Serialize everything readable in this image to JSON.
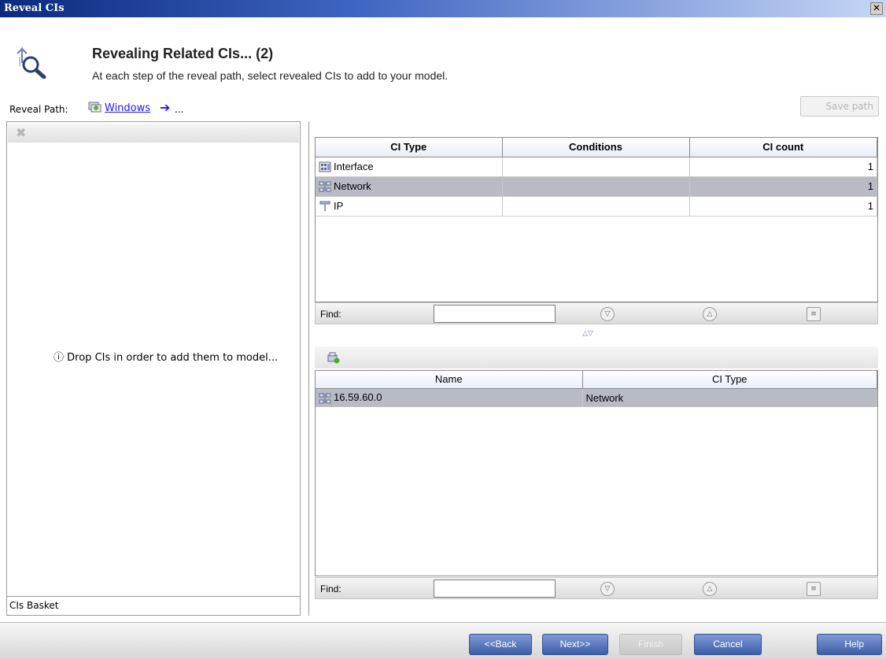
{
  "window": {
    "title": "Reveal CIs",
    "close_glyph": "✕"
  },
  "header": {
    "title": "Revealing Related CIs... (2)",
    "subtitle": "At each step of the reveal path, select revealed CIs to add to your model.",
    "icon": "reveal-magnifier-icon"
  },
  "reveal_path": {
    "label": "Reveal Path:",
    "link": "Windows",
    "arrow": "➔",
    "ellipsis": "...",
    "save_button": "Save path"
  },
  "basket": {
    "message": "Drop CIs in order to add them to model...",
    "info_glyph": "ⓘ",
    "label": "CIs Basket"
  },
  "ci_table": {
    "headers": [
      "CI Type",
      "Conditions",
      "CI count"
    ],
    "rows": [
      {
        "type": "Interface",
        "conditions": "",
        "count": "1",
        "icon": "interface-icon",
        "selected": false
      },
      {
        "type": "Network",
        "conditions": "",
        "count": "1",
        "icon": "network-icon",
        "selected": true
      },
      {
        "type": "IP",
        "conditions": "",
        "count": "1",
        "icon": "ip-icon",
        "selected": false
      }
    ]
  },
  "find": {
    "label": "Find:",
    "value": ""
  },
  "result_table": {
    "headers": [
      "Name",
      "CI Type"
    ],
    "rows": [
      {
        "name": "16.59.60.0",
        "type": "Network",
        "icon": "network-icon",
        "selected": true
      }
    ]
  },
  "buttons": {
    "back": "<<Back",
    "next": "Next>>",
    "finish": "Finish",
    "cancel": "Cancel",
    "help": "Help"
  }
}
